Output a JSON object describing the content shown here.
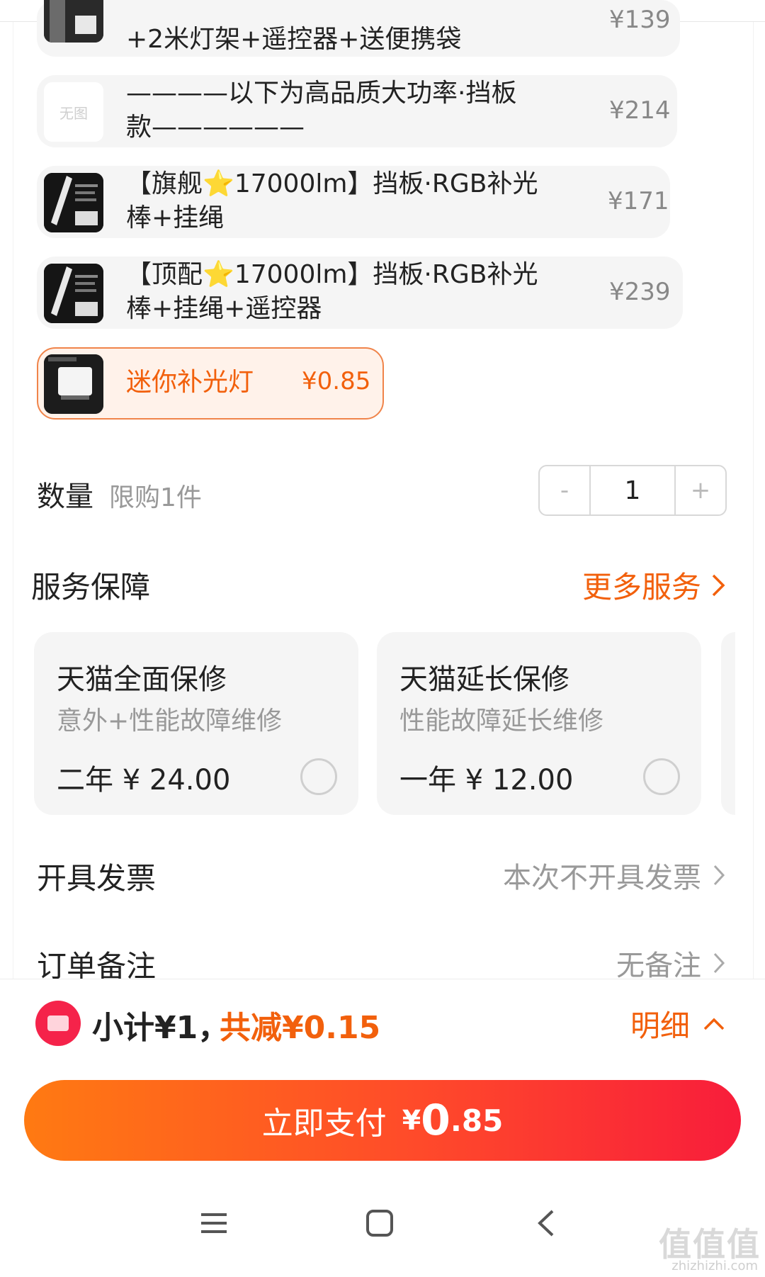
{
  "sku_options": [
    {
      "label_line1": "+2米灯架+遥控器+送便携袋",
      "price": "¥139"
    },
    {
      "thumb_text": "无图",
      "label_line1": "————以下为高品质大功率·挡板",
      "label_line2": "款——————",
      "price": "¥214"
    },
    {
      "label_line1": "【旗舰⭐17000lm】挡板·RGB补光",
      "label_line2": "棒+挂绳",
      "price": "¥171"
    },
    {
      "label_line1": "【顶配⭐17000lm】挡板·RGB补光",
      "label_line2": "棒+挂绳+遥控器",
      "price": "¥239"
    },
    {
      "label_line1": "迷你补光灯",
      "price": "¥0.85",
      "selected": true
    }
  ],
  "quantity": {
    "label": "数量",
    "limit": "限购1件",
    "minus": "-",
    "value": "1",
    "plus": "+"
  },
  "services": {
    "title": "服务保障",
    "more": "更多服务",
    "cards": [
      {
        "name": "天猫全面保修",
        "desc": "意外+性能故障维修",
        "price": "二年 ¥ 24.00"
      },
      {
        "name": "天猫延长保修",
        "desc": "性能故障延长维修",
        "price": "一年 ¥ 12.00"
      }
    ]
  },
  "invoice": {
    "label": "开具发票",
    "value": "本次不开具发票"
  },
  "remark": {
    "label": "订单备注",
    "value": "无备注"
  },
  "summary": {
    "subtotal": "小计¥1，",
    "reduced": "共减¥0.15",
    "detail": "明细"
  },
  "pay_button": {
    "text": "立即支付",
    "yen": "¥",
    "amount_int": "0",
    "amount_dec": ".85"
  },
  "watermark": {
    "main": "值值值",
    "sub": "zhizhizhi.com"
  },
  "colors": {
    "accent": "#f2600c",
    "pay_start": "#ff7a12",
    "pay_end": "#f81d3b"
  }
}
